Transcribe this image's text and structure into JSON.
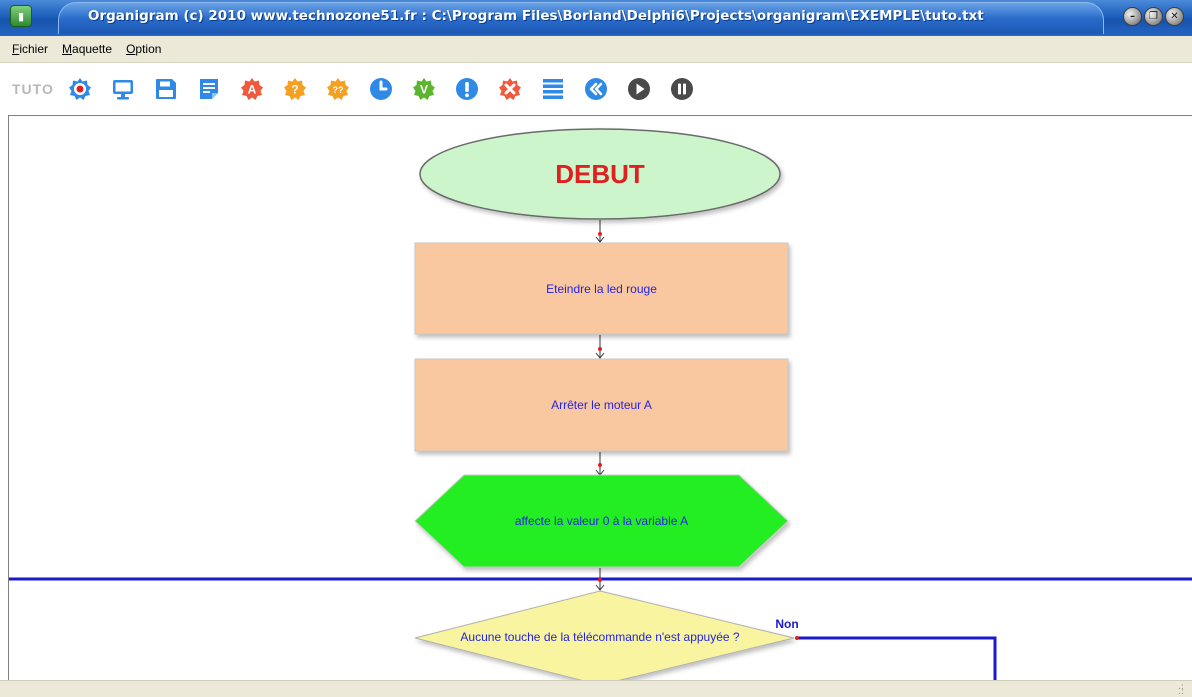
{
  "window": {
    "title": "Organigram (c) 2010 www.technozone51.fr : C:\\Program Files\\Borland\\Delphi6\\Projects\\organigram\\EXEMPLE\\tuto.txt",
    "app_icon": "traffic-light-icon",
    "controls": [
      "minimize-icon",
      "restore-icon",
      "close-icon"
    ]
  },
  "menu": {
    "items": [
      "Fichier",
      "Maquette",
      "Option"
    ]
  },
  "toolbar": {
    "label": "TUTO",
    "buttons": [
      {
        "icon": "record-icon",
        "color": "#2e8ae6"
      },
      {
        "icon": "monitor-icon",
        "color": "#2e8ae6"
      },
      {
        "icon": "save-icon",
        "color": "#2e8ae6"
      },
      {
        "icon": "document-icon",
        "color": "#2e8ae6"
      },
      {
        "icon": "action-a-icon",
        "color": "#f05a3c",
        "glyph": "A"
      },
      {
        "icon": "test-icon",
        "color": "#f5a020",
        "glyph": "?"
      },
      {
        "icon": "test-2-icon",
        "color": "#f5a020",
        "glyph": "??"
      },
      {
        "icon": "clock-icon",
        "color": "#2e8ae6"
      },
      {
        "icon": "variable-icon",
        "color": "#5bb52e",
        "glyph": "V"
      },
      {
        "icon": "info-icon",
        "color": "#2e8ae6",
        "glyph": "!"
      },
      {
        "icon": "delete-icon",
        "color": "#f05a3c",
        "glyph": "✕"
      },
      {
        "icon": "list-icon",
        "color": "#2e8ae6"
      },
      {
        "icon": "rewind-icon",
        "color": "#2e8ae6",
        "glyph": "«"
      },
      {
        "icon": "play-icon",
        "color": "#4a4a4a"
      },
      {
        "icon": "pause-icon",
        "color": "#4a4a4a"
      }
    ]
  },
  "flowchart": {
    "start": {
      "label": "DEBUT",
      "fill": "#ccf5cc",
      "text_color": "#e02020"
    },
    "step_1": {
      "label": "Eteindre la led rouge",
      "fill": "#fac8a0"
    },
    "step_2": {
      "label": "Arrêter le moteur A",
      "fill": "#fac8a0"
    },
    "step_3": {
      "label": "affecte la valeur 0 à la variable A",
      "fill": "#22ee22"
    },
    "decision": {
      "label": "Aucune touche de la télécommande n'est appuyée ?",
      "fill": "#f8f4a0",
      "no_label": "Non"
    },
    "loop_line_color": "#1a1acc",
    "text_color": "#2424e0"
  }
}
